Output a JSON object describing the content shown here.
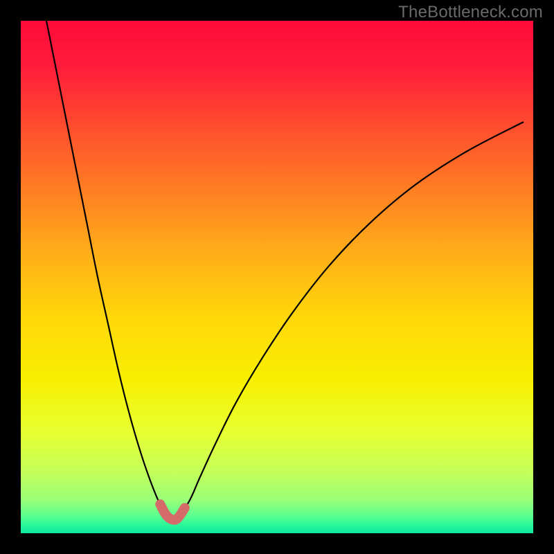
{
  "watermark": {
    "text": "TheBottleneck.com"
  },
  "colors": {
    "gradient_stops": [
      {
        "offset": 0.0,
        "color": "#ff0a3a"
      },
      {
        "offset": 0.09,
        "color": "#ff1d3a"
      },
      {
        "offset": 0.2,
        "color": "#ff4a2f"
      },
      {
        "offset": 0.32,
        "color": "#ff7a24"
      },
      {
        "offset": 0.45,
        "color": "#ffad18"
      },
      {
        "offset": 0.58,
        "color": "#ffd80a"
      },
      {
        "offset": 0.7,
        "color": "#f8ef00"
      },
      {
        "offset": 0.8,
        "color": "#e8ff30"
      },
      {
        "offset": 0.88,
        "color": "#c4ff5a"
      },
      {
        "offset": 0.935,
        "color": "#9bff78"
      },
      {
        "offset": 0.965,
        "color": "#5dff8e"
      },
      {
        "offset": 0.985,
        "color": "#28f79b"
      },
      {
        "offset": 1.0,
        "color": "#0de89e"
      }
    ],
    "curve_stroke": "#000000",
    "highlight_stroke": "#d46a6a"
  },
  "chart_data": {
    "type": "line",
    "title": "",
    "xlabel": "",
    "ylabel": "",
    "xlim": [
      0,
      100
    ],
    "ylim": [
      0,
      100
    ],
    "series": [
      {
        "name": "bottleneck-curve",
        "x": [
          5,
          7,
          9,
          11,
          13,
          15,
          17,
          19,
          21,
          23,
          25,
          27,
          28.5,
          30,
          31,
          33,
          35,
          38,
          42,
          47,
          53,
          60,
          68,
          77,
          87,
          98
        ],
        "y": [
          100,
          90,
          80,
          70,
          60,
          50,
          41,
          32,
          24,
          17,
          11,
          6,
          3.4,
          2.6,
          3.4,
          6.5,
          11,
          17.5,
          25.5,
          34,
          43,
          52,
          60.4,
          68,
          74.5,
          80.2
        ]
      }
    ],
    "annotations": [
      {
        "name": "minimum-highlight",
        "x_range": [
          27.2,
          32.0
        ],
        "y_range": [
          2.6,
          5.5
        ]
      }
    ]
  }
}
